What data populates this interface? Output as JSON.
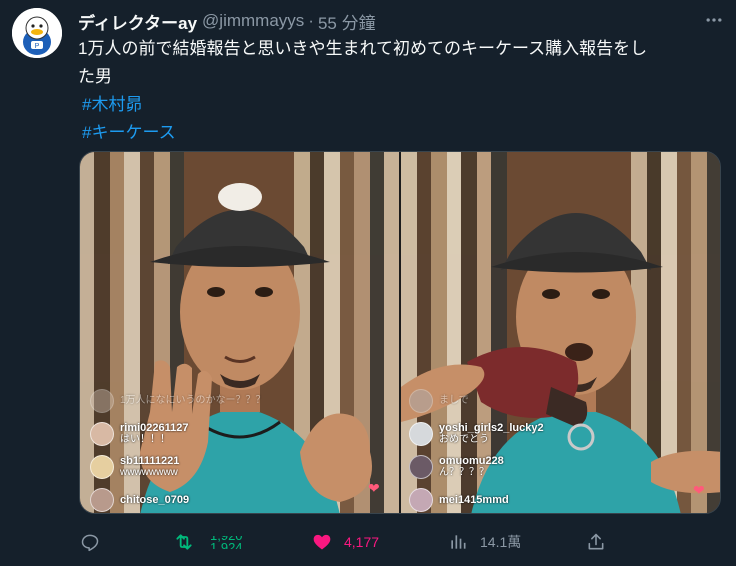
{
  "tweet": {
    "display_name": "ディレクターay",
    "handle": "@jimmmayys",
    "separator": "·",
    "time": "55 分鐘",
    "text_line1": "1万人の前で結婚報告と思いきや生まれて初めてのキーケース購入報告をし",
    "text_line2": "た男",
    "hashtags": [
      "#木村昴",
      "#キーケース"
    ]
  },
  "media": {
    "left_frame": {
      "comments": [
        {
          "user": "",
          "msg": "1万人になにいうのかなー？？？",
          "faded": true,
          "avatar_color": "#c9b7a8"
        },
        {
          "user": "rimi02261127",
          "msg": "はい！！！",
          "faded": false,
          "avatar_color": "#d8b9a4"
        },
        {
          "user": "sb11111221",
          "msg": "wwwwwwww",
          "faded": false,
          "avatar_color": "#e6cfa0"
        },
        {
          "user": "chitose_0709",
          "msg": "",
          "faded": false,
          "avatar_color": "#b89a8c"
        }
      ]
    },
    "right_frame": {
      "comments": [
        {
          "user": "",
          "msg": "ましで",
          "faded": true,
          "avatar_color": "#a8b0b8"
        },
        {
          "user": "yoshi_girls2_lucky2",
          "msg": "おめでとう",
          "faded": false,
          "avatar_color": "#d6d9dc"
        },
        {
          "user": "omuomu228",
          "msg": "ん？？？？",
          "faded": false,
          "avatar_color": "#6b5a66"
        },
        {
          "user": "mei1415mmd",
          "msg": "",
          "faded": false,
          "avatar_color": "#c4a8b4"
        }
      ]
    }
  },
  "actions": {
    "retweet_count_prev": "1,920",
    "retweet_count": "1,924",
    "like_count": "4,177",
    "view_count": "14.1萬"
  },
  "icons": {
    "reply": "reply-icon",
    "retweet": "retweet-icon",
    "like": "heart-icon",
    "views": "views-icon",
    "share": "share-icon",
    "more": "more-icon"
  },
  "colors": {
    "background": "#15202b",
    "accent": "#1d9bf0",
    "retweet": "#00ba7c",
    "like": "#f91880",
    "muted": "#8b98a5"
  }
}
